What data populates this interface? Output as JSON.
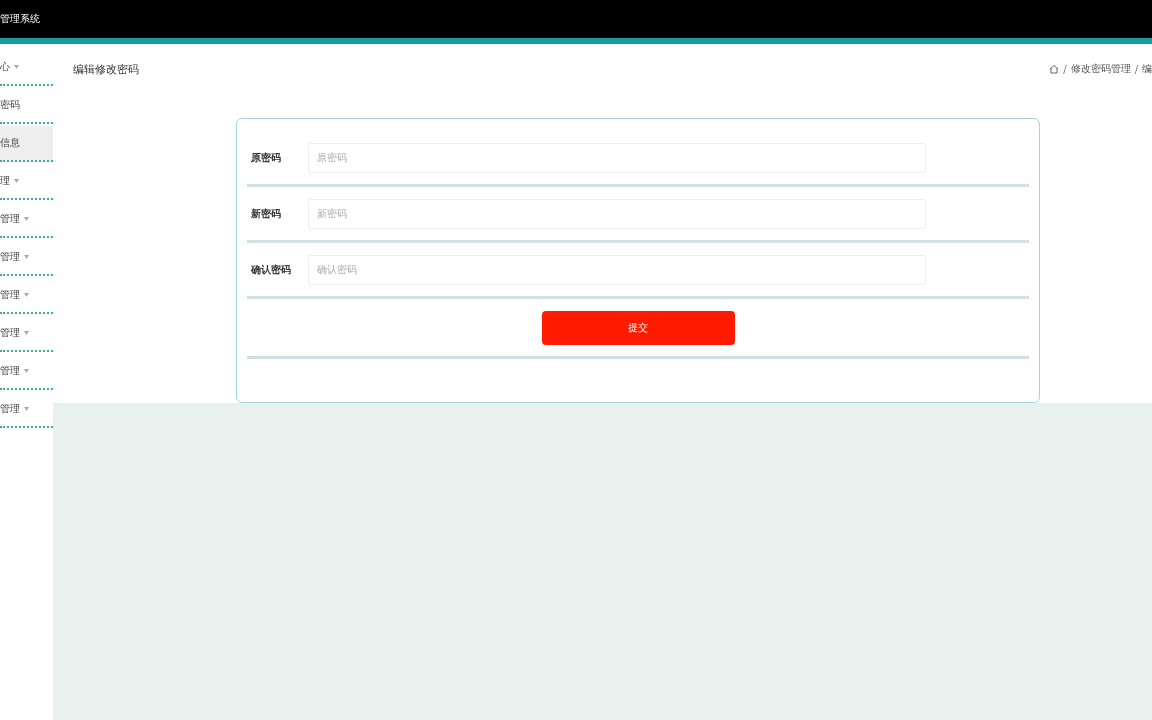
{
  "header": {
    "title": "管理系统"
  },
  "sidebar": {
    "items": [
      {
        "label": "心",
        "kind": "menu",
        "selected": false
      },
      {
        "label": "密码",
        "kind": "link",
        "selected": false
      },
      {
        "label": "信息",
        "kind": "link",
        "selected": true
      },
      {
        "label": "理",
        "kind": "menu",
        "selected": false
      },
      {
        "label": "管理",
        "kind": "menu",
        "selected": false
      },
      {
        "label": "管理",
        "kind": "menu",
        "selected": false
      },
      {
        "label": "管理",
        "kind": "menu",
        "selected": false
      },
      {
        "label": "管理",
        "kind": "menu",
        "selected": false
      },
      {
        "label": "管理",
        "kind": "menu",
        "selected": false
      },
      {
        "label": "管理",
        "kind": "menu",
        "selected": false
      }
    ]
  },
  "page_title": "编辑修改密码",
  "breadcrumb": {
    "separator": "/",
    "items": [
      "修改密码管理",
      "编"
    ]
  },
  "form": {
    "fields": [
      {
        "label": "原密码",
        "placeholder": "原密码"
      },
      {
        "label": "新密码",
        "placeholder": "新密码"
      },
      {
        "label": "确认密码",
        "placeholder": "确认密码"
      }
    ],
    "submit": "提交"
  }
}
